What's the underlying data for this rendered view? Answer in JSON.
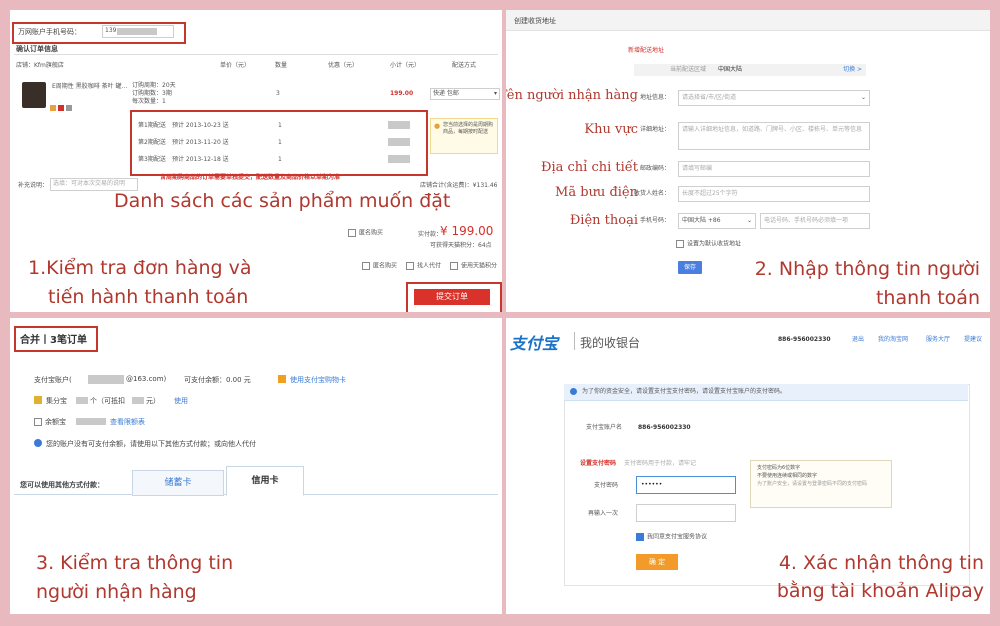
{
  "panel1": {
    "top_label": "万网账户手机号码：",
    "phone_prefix": "139",
    "confirm_heading": "确认订单信息",
    "store_name": "店铺：Kfm旗舰店",
    "col_headers": [
      "单价（元）",
      "数量",
      "优惠（元）",
      "小计（元）",
      "配送方式"
    ],
    "product_name": "E周期性 黑胶咖啡 茶叶 罐...",
    "product_meta": [
      "订购周期：20天",
      "订购期数：3期",
      "每次数量：1"
    ],
    "qty": "3",
    "price_cell": "199.00",
    "shipping": "快递 包邮",
    "periods": [
      {
        "label": "第1期配送",
        "date": "预计 2013-10-23 送",
        "qty": "1"
      },
      {
        "label": "第2期配送",
        "date": "预计 2013-11-20 送",
        "qty": "1"
      },
      {
        "label": "第3期配送",
        "date": "预计 2013-12-18 送",
        "qty": "1"
      }
    ],
    "notice": "您当前选择的是周期购商品，每期按时配送",
    "message_label": "补充说明：",
    "message_placeholder": "选填：可对本次交易的说明",
    "red_notice": "含周期购商品的订单需要单独提交，配送数量及商品价格以单期为准",
    "store_total": "店铺合计(含运费)：¥131.46",
    "anon_label": "匿名购买",
    "total_label": "实付款：",
    "total_value": "¥ 199.00",
    "points_label": "可获得天猫积分：64点",
    "opt_1": "匿名购买",
    "opt_2": "找人代付",
    "opt_3": "使用天猫积分",
    "submit": "提交订单",
    "caption_main": "Danh sách các sản phẩm muốn đặt",
    "caption_line1": "1.Kiểm tra đơn hàng và",
    "caption_line2": "tiến hành thanh toán"
  },
  "panel2": {
    "title": "创建收货地址",
    "subtitle": "新增配送地址",
    "region_label": "当前配送区域",
    "region_value": "中国大陆",
    "switch_label": "切换 >",
    "fields": [
      {
        "vn": "Tên người nhận hàng",
        "cn": "地址信息：",
        "ph": "请选择省/市/区/街道"
      },
      {
        "vn": "Khu vực",
        "cn": "详细地址：",
        "ph": "请输入详细地址信息，如道路、门牌号、小区、楼栋号、单元等信息"
      },
      {
        "vn": "Địa chỉ chi tiết",
        "cn": "邮政编码：",
        "ph": "请填写邮编"
      },
      {
        "vn": "Mã bưu điện",
        "cn": "收货人姓名：",
        "ph": "长度不超过25个字符"
      },
      {
        "vn": "Điện thoại",
        "cn": "手机号码：",
        "ph": "中国大陆 +86",
        "ph2": "电话号码、手机号码必须填一项"
      }
    ],
    "default_label": "设置为默认收货地址",
    "save_button": "保存",
    "caption_line1": "2. Nhập thông tin người",
    "caption_line2": "thanh toán"
  },
  "panel3": {
    "header": "合并丨3笔订单",
    "account_label": "支付宝账户(",
    "account_suffix": "@163.com)",
    "balance": "可支付余额：0.00 元",
    "pay_link": "使用支付宝购物卡",
    "row2": "集分宝",
    "row2b": "个（可抵扣",
    "row2c": "元）",
    "row2_link": "使用",
    "row3": "余额宝",
    "row3_link": "查看限额表",
    "info": "您的账户没有可支付余额，请使用以下其他方式付款；或向他人代付",
    "pay_other_label": "您可以使用其他方式付款：",
    "tab1": "储蓄卡",
    "tab2": "信用卡",
    "caption_line1": "3. Kiểm tra thông tin",
    "caption_line2": "người nhận hàng"
  },
  "panel4": {
    "logo": "支付宝",
    "cashier": "我的收银台",
    "account_top": "886-956002330",
    "nav": [
      "退出",
      "我的淘宝网",
      "服务大厅",
      "提建议"
    ],
    "banner": "为了你的资金安全，请设置支付宝支付密码，请设置支付宝账户的支付密码。",
    "account_label": "支付宝账户名",
    "account_value": "886-956002330",
    "set_pwd": "设置支付密码",
    "set_pwd_hint": "支付密码用于付款，请牢记",
    "pwd_label": "支付密码",
    "pwd_dots": "••••••",
    "confirm_label": "再输入一次",
    "tip_lines": [
      "支付密码为6位数字",
      "不要使用连续或相同的数字",
      "为了账户安全，请设置与登录密码不同的支付密码"
    ],
    "agree": "我同意支付宝服务协议",
    "ok_button": "确 定",
    "caption_line1": "4. Xác nhận thông tin",
    "caption_line2": "bằng tài khoản Alipay"
  }
}
